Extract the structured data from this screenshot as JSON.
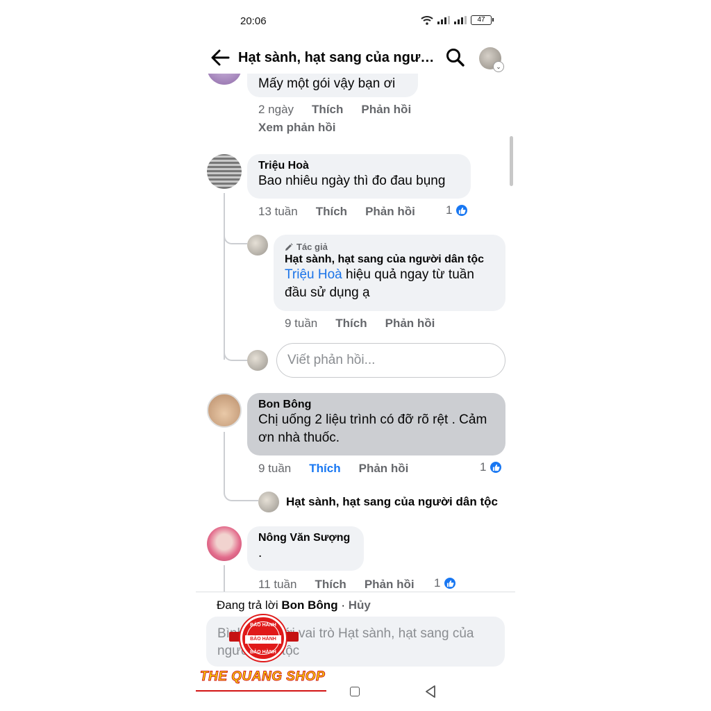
{
  "status_bar": {
    "time": "20:06",
    "battery": "47"
  },
  "header": {
    "title": "Hạt sành, hạt sang của người dân tộc"
  },
  "comments": [
    {
      "text": "Mấy một gói vậy bạn ơi",
      "time": "2 ngày",
      "like_label": "Thích",
      "reply_label": "Phản hồi",
      "view_replies": "Xem phản hồi"
    },
    {
      "author": "Triệu Hoà",
      "text": "Bao nhiêu ngày thì đo đau bụng",
      "time": "13 tuần",
      "like_label": "Thích",
      "reply_label": "Phản hồi",
      "like_count": "1"
    },
    {
      "author": "Bon Bông",
      "text": "Chị uống 2 liệu trình có đỡ rõ rệt . Cảm ơn nhà thuốc.",
      "time": "9 tuần",
      "like_label": "Thích",
      "reply_label": "Phản hồi",
      "like_count": "1"
    },
    {
      "author": "Nông Văn Sượng",
      "text": ".",
      "time": "11 tuần",
      "like_label": "Thích",
      "reply_label": "Phản hồi",
      "like_count": "1"
    }
  ],
  "author_reply": {
    "badge": "Tác giả",
    "author": "Hạt sành, hạt sang của người dân tộc",
    "mention": "Triệu Hoà",
    "text": " hiệu quả ngay từ tuần đầu sử dụng ạ",
    "time": "9 tuần",
    "like_label": "Thích",
    "reply_label": "Phản hồi"
  },
  "reply_input": {
    "placeholder": "Viết phản hồi..."
  },
  "collapsed_reply": {
    "author": "Hạt sành, hạt sang của người dân tộc"
  },
  "replying_bar": {
    "prefix": "Đang trả lời",
    "name": "Bon Bông",
    "separator": "·",
    "cancel": "Hủy"
  },
  "compose": {
    "placeholder": "Bình luận với vai trò Hạt sành, hạt sang của người dân tộc"
  },
  "watermark": {
    "shop_name": "THE QUANG SHOP",
    "seal_top": "BẢO HÀNH",
    "seal_mid": "BẢO HÀNH",
    "seal_bottom": "BẢO HÀNH"
  },
  "colors": {
    "link": "#1877f2",
    "mention": "#1a73e8",
    "meta": "#65676b",
    "bubble": "#f0f2f5",
    "bubble_selected": "#ccced2"
  }
}
